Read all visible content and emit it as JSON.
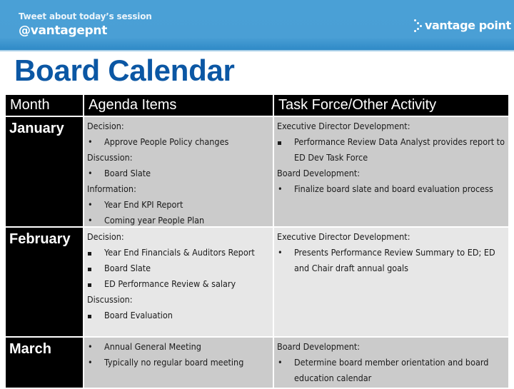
{
  "banner": {
    "tweet_prompt": "Tweet about today’s session",
    "handle": "@vantagepnt",
    "logo_text": "vantage point",
    "logo_icon": "dotted-chevron-icon"
  },
  "page_title": "Board Calendar",
  "colors": {
    "banner": "#4a9fd5",
    "title": "#0b57a4",
    "header_bg": "#000000",
    "row_gray": "#cbcbcb",
    "row_light": "#e7e7e7"
  },
  "table": {
    "headers": [
      "Month",
      "Agenda Items",
      "Task Force/Other Activity"
    ],
    "rows": [
      {
        "month": "January",
        "agenda": [
          {
            "type": "label",
            "text": "Decision:"
          },
          {
            "type": "bullet",
            "text": "Approve People Policy changes"
          },
          {
            "type": "label",
            "text": "Discussion:"
          },
          {
            "type": "bullet",
            "text": "Board Slate"
          },
          {
            "type": "label",
            "text": "Information:"
          },
          {
            "type": "bullet",
            "text": "Year End KPI Report"
          },
          {
            "type": "bullet",
            "text": "Coming year People Plan"
          }
        ],
        "task_force": [
          {
            "type": "label",
            "text": "Executive Director Development:"
          },
          {
            "type": "square",
            "text": "Performance Review Data Analyst provides report to ED Dev Task Force"
          },
          {
            "type": "label",
            "text": "Board Development:"
          },
          {
            "type": "bullet",
            "text": "Finalize board slate and board evaluation process"
          }
        ]
      },
      {
        "month": "February",
        "agenda": [
          {
            "type": "label",
            "text": "Decision:"
          },
          {
            "type": "square",
            "text": "Year End Financials & Auditors Report"
          },
          {
            "type": "square",
            "text": "Board Slate"
          },
          {
            "type": "square",
            "text": "ED Performance Review & salary"
          },
          {
            "type": "label",
            "text": "Discussion:"
          },
          {
            "type": "square",
            "text": "Board Evaluation"
          }
        ],
        "task_force": [
          {
            "type": "label",
            "text": "Executive Director Development:"
          },
          {
            "type": "bullet",
            "text": "Presents Performance Review Summary to ED; ED and Chair draft annual goals"
          }
        ]
      },
      {
        "month": "March",
        "agenda": [
          {
            "type": "bullet",
            "text": "Annual General Meeting"
          },
          {
            "type": "bullet",
            "text": "Typically no regular board meeting"
          }
        ],
        "task_force": [
          {
            "type": "label",
            "text": "Board Development:"
          },
          {
            "type": "bullet",
            "text": "Determine board member orientation and board education calendar"
          }
        ]
      }
    ]
  }
}
